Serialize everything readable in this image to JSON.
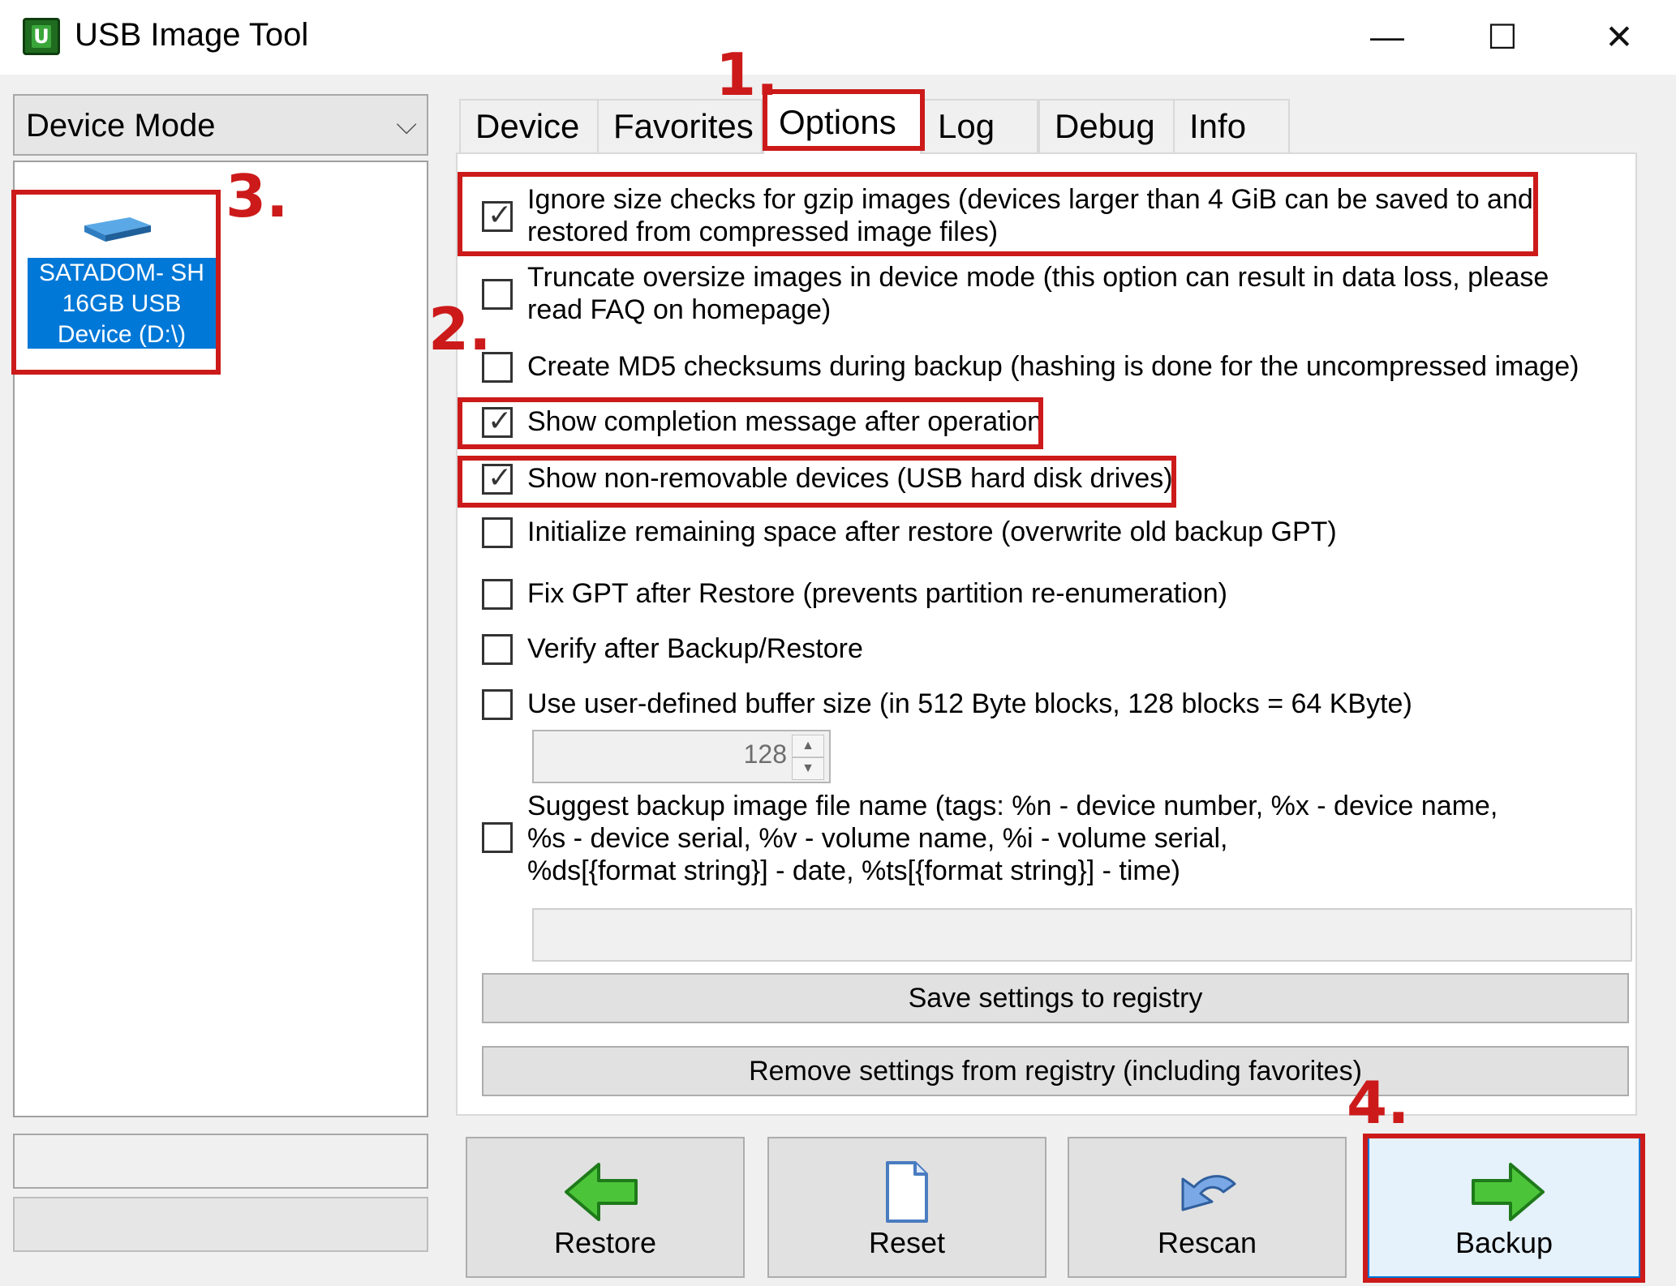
{
  "window": {
    "title": "USB Image Tool",
    "app_icon_letter": "U",
    "minimize": "—",
    "maximize": "☐",
    "close": "✕"
  },
  "sidebar": {
    "mode": "Device Mode",
    "chevron": "⌵",
    "device": {
      "line1": "SATADOM- SH",
      "line2": "16GB USB",
      "line3": "Device (D:\\)"
    }
  },
  "tabs": [
    {
      "label": "Device"
    },
    {
      "label": "Favorites"
    },
    {
      "label": "Options"
    },
    {
      "label": "Log"
    },
    {
      "label": "Debug"
    },
    {
      "label": "Info"
    }
  ],
  "options": [
    {
      "checked": true,
      "line1": "Ignore size checks for gzip images (devices larger than 4 GiB can be saved to and",
      "line2": "restored from compressed image files)"
    },
    {
      "checked": false,
      "line1": "Truncate oversize images in device mode (this option can result in data loss, please",
      "line2": "read FAQ on homepage)"
    },
    {
      "checked": false,
      "line1": "Create MD5 checksums during backup (hashing is done for the uncompressed image)"
    },
    {
      "checked": true,
      "line1": "Show completion message after operation"
    },
    {
      "checked": true,
      "line1": "Show non-removable devices (USB hard disk drives)"
    },
    {
      "checked": false,
      "line1": "Initialize remaining space after restore (overwrite old backup GPT)"
    },
    {
      "checked": false,
      "line1": "Fix GPT after Restore (prevents partition re-enumeration)"
    },
    {
      "checked": false,
      "line1": "Verify after Backup/Restore"
    },
    {
      "checked": false,
      "line1": "Use user-defined buffer size (in 512 Byte blocks, 128 blocks = 64 KByte)"
    },
    {
      "checked": false,
      "line1": "Suggest backup image file name (tags: %n - device number, %x - device name,",
      "line2": "%s - device serial, %v - volume name, %i - volume serial,",
      "line3": "%ds[{format string}] - date, %ts[{format string}] - time)"
    }
  ],
  "checkmark": "✓",
  "buffer_size": "128",
  "spin_up": "▲",
  "spin_down": "▼",
  "save_settings": "Save settings to registry",
  "remove_settings": "Remove settings from registry (including favorites)",
  "actions": {
    "restore": "Restore",
    "reset": "Reset",
    "rescan": "Rescan",
    "backup": "Backup"
  },
  "annotations": {
    "a1": "1.",
    "a2": "2.",
    "a3": "3.",
    "a4": "4."
  },
  "colors": {
    "annotation_red": "#cc1a1a",
    "selection_blue": "#0078d7"
  }
}
